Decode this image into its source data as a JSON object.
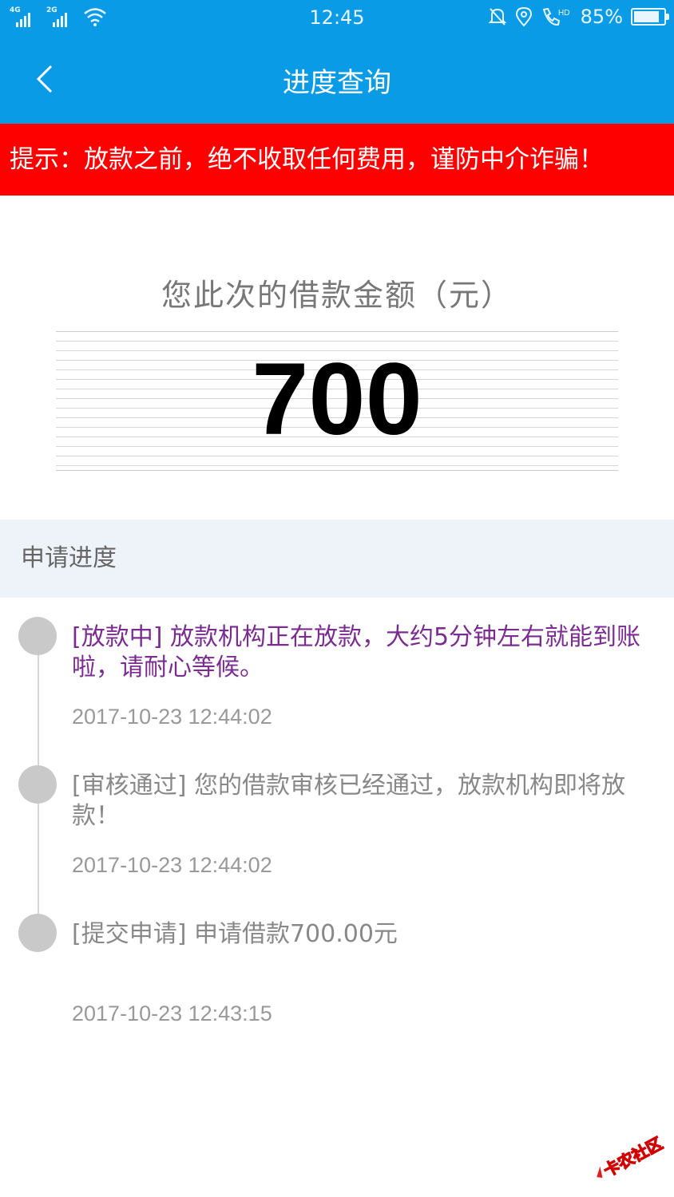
{
  "status_bar": {
    "network_1": "4G",
    "network_2": "2G",
    "time": "12:45",
    "call_hd": "HD",
    "battery_percent": "85%",
    "battery_level": 0.85
  },
  "nav": {
    "title": "进度查询"
  },
  "banner": {
    "text": "提示：放款之前，绝不收取任何费用，谨防中介诈骗！",
    "color": "#fe0000"
  },
  "amount": {
    "label": "您此次的借款金额（元）",
    "value": "700"
  },
  "progress": {
    "header": "申请进度",
    "items": [
      {
        "text": "[放款中] 放款机构正在放款，大约5分钟左右就能到账啦，请耐心等候。",
        "time": "2017-10-23 12:44:02",
        "state": "active"
      },
      {
        "text": "[审核通过] 您的借款审核已经通过，放款机构即将放款！",
        "time": "2017-10-23 12:44:02",
        "state": "done"
      },
      {
        "text": "[提交申请] 申请借款700.00元",
        "time": "2017-10-23 12:43:15",
        "state": "done"
      }
    ]
  },
  "watermark": {
    "text": "卡农社区"
  },
  "colors": {
    "primary": "#0a9be6",
    "active_text": "#7a2c91",
    "section_bg": "#eef2f9"
  }
}
